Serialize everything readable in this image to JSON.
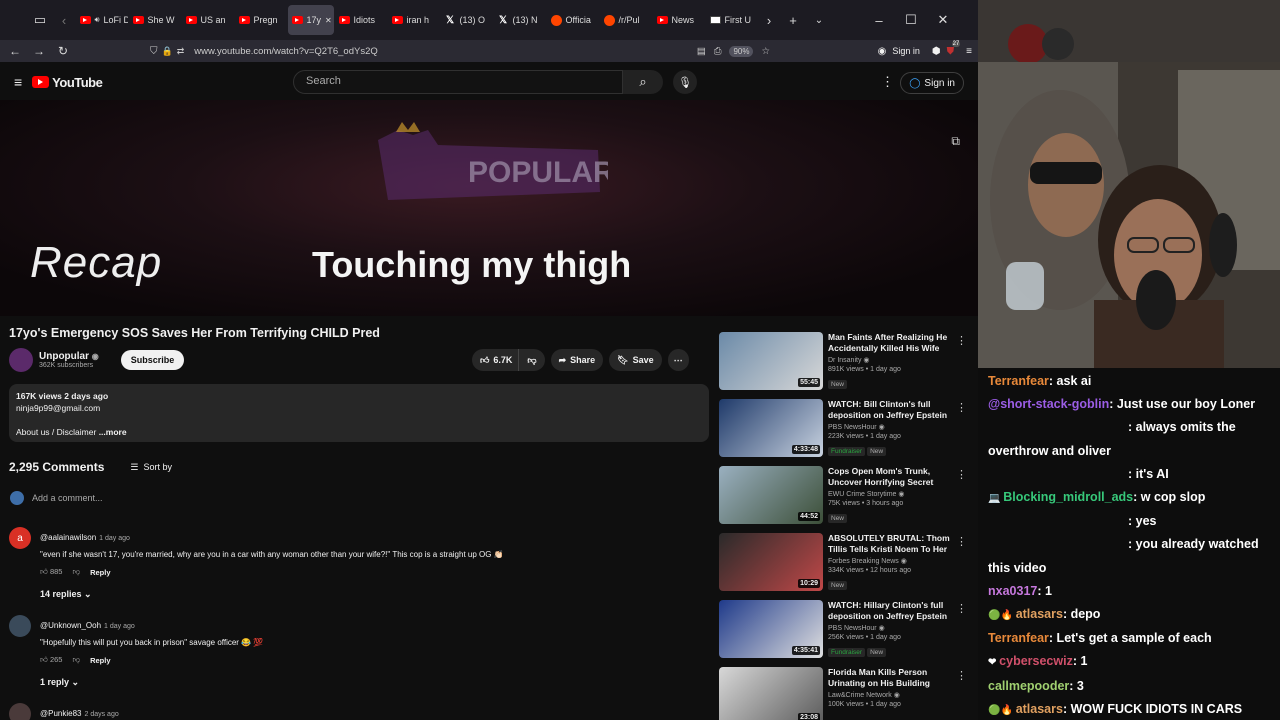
{
  "browser": {
    "tabs": [
      {
        "label": "LoFi D",
        "favicon": "youtube",
        "audio": true
      },
      {
        "label": "She W",
        "favicon": "youtube"
      },
      {
        "label": "US an",
        "favicon": "youtube"
      },
      {
        "label": "Pregn",
        "favicon": "youtube"
      },
      {
        "label": "17y",
        "favicon": "youtube",
        "active": true
      },
      {
        "label": "Idiots",
        "favicon": "youtube"
      },
      {
        "label": "iran h",
        "favicon": "youtube"
      },
      {
        "label": "(13) O",
        "favicon": "x"
      },
      {
        "label": "(13) N",
        "favicon": "x"
      },
      {
        "label": "Officia",
        "favicon": "reddit"
      },
      {
        "label": "/r/Pul",
        "favicon": "reddit"
      },
      {
        "label": "News",
        "favicon": "youtube"
      },
      {
        "label": "First U",
        "favicon": "news"
      }
    ],
    "url": "www.youtube.com/watch?v=Q2T6_odYs2Q",
    "zoom": "90%",
    "signin_label": "Sign in",
    "extension_badge": "27"
  },
  "youtube": {
    "logo_text": "YouTube",
    "search_placeholder": "Search",
    "signin_label": "Sign in",
    "player": {
      "watermark": "POPULAR",
      "left_text": "Recap",
      "caption": "Touching my thigh"
    },
    "video": {
      "title": "17yo's Emergency SOS Saves Her From Terrifying CHILD Pred",
      "channel": "Unpopular",
      "subscribers": "362K subscribers",
      "subscribe_label": "Subscribe",
      "likes": "6.7K",
      "share_label": "Share",
      "save_label": "Save"
    },
    "description": {
      "stats": "167K views  2 days ago",
      "email": "ninja9p99@gmail.com",
      "about": "About us / Disclaimer",
      "more": "...more"
    },
    "comments": {
      "count": "2,295 Comments",
      "sort_label": "Sort by",
      "add_placeholder": "Add a comment...",
      "items": [
        {
          "user": "@aalainawilson",
          "time": "1 day ago",
          "text": "\"even if she wasn't 17, you're married, why are you in a car with any woman other than your wife?!\" This cop is a straight up OG 👏🏻",
          "likes": "885",
          "reply_label": "Reply",
          "replies": "14 replies",
          "avatar_letter": "a",
          "avatar_color": "#d93025"
        },
        {
          "user": "@Unknown_Ooh",
          "time": "1 day ago",
          "text": "\"Hopefully this will put you back in prison\" savage officer 😂 💯",
          "likes": "265",
          "reply_label": "Reply",
          "replies": "1 reply",
          "avatar_letter": "",
          "avatar_color": "#3a4a5a"
        },
        {
          "user": "@Punkie83",
          "time": "2 days ago",
          "text": "",
          "likes": "",
          "reply_label": "",
          "replies": "",
          "avatar_letter": "",
          "avatar_color": "#4a3a3a"
        }
      ]
    },
    "recommendations": [
      {
        "title": "Man Faints After Realizing He Accidentally Killed His Wife",
        "channel": "Dr Insanity",
        "meta": "891K views • 1 day ago",
        "duration": "55:45",
        "badges": [
          "New"
        ],
        "thumb": [
          "#6b8aa8",
          "#d8d8d8"
        ]
      },
      {
        "title": "WATCH: Bill Clinton's full deposition on Jeffrey Epstein ...",
        "channel": "PBS NewsHour",
        "meta": "223K views • 1 day ago",
        "duration": "4:33:48",
        "badges": [
          "Fundraiser",
          "New"
        ],
        "thumb": [
          "#1f3a6a",
          "#c9d3e0"
        ]
      },
      {
        "title": "Cops Open Mom's Trunk, Uncover Horrifying Secret",
        "channel": "EWU Crime Storytime",
        "meta": "75K views • 3 hours ago",
        "duration": "44:52",
        "badges": [
          "New"
        ],
        "thumb": [
          "#9ab0c0",
          "#3c4f38"
        ]
      },
      {
        "title": "ABSOLUTELY BRUTAL: Thom Tillis Tells Kristi Noem To Her ...",
        "channel": "Forbes Breaking News",
        "meta": "334K views • 12 hours ago",
        "duration": "10:29",
        "badges": [
          "New"
        ],
        "thumb": [
          "#2a2a2a",
          "#c04848"
        ]
      },
      {
        "title": "WATCH: Hillary Clinton's full deposition on Jeffrey Epstein ...",
        "channel": "PBS NewsHour",
        "meta": "256K views • 1 day ago",
        "duration": "4:35:41",
        "badges": [
          "Fundraiser",
          "New"
        ],
        "thumb": [
          "#1f3a8a",
          "#e0e0e0"
        ]
      },
      {
        "title": "Florida Man Kills Person Urinating on His Building",
        "channel": "Law&Crime Network",
        "meta": "100K views • 1 day ago",
        "duration": "23:08",
        "badges": [],
        "thumb": [
          "#d8d8d8",
          "#5a5a5a"
        ]
      }
    ]
  },
  "stream_chat": [
    {
      "user": "Terranfear",
      "color": "#e8893a",
      "msg": ": ask ai"
    },
    {
      "user": "@short-stack-goblin",
      "color": "#9b5de5",
      "msg": ": Just use our boy Loner"
    },
    {
      "user": "",
      "color": "#ffffff",
      "msg": ": always omits the",
      "cont": true
    },
    {
      "user": "",
      "color": "#ffffff",
      "msg": "overthrow and oliver"
    },
    {
      "user": "",
      "color": "#ffffff",
      "msg": ": it's AI",
      "cont": true
    },
    {
      "user": "Blocking_midroll_ads",
      "color": "#37c87a",
      "msg": ": w cop slop",
      "badge": "💻"
    },
    {
      "user": "",
      "color": "#ffffff",
      "msg": ": yes",
      "cont": true
    },
    {
      "user": "",
      "color": "#ffffff",
      "msg": ": you already watched",
      "cont": true
    },
    {
      "user": "",
      "color": "#ffffff",
      "msg": "this video"
    },
    {
      "user": "nxa0317",
      "color": "#c678dd",
      "msg": ": 1"
    },
    {
      "user": "atlasars",
      "color": "#e0a060",
      "msg": ": depo",
      "badge": "🟢🔥"
    },
    {
      "user": "Terranfear",
      "color": "#e8893a",
      "msg": ": Let's get a sample of each"
    },
    {
      "user": "cybersecwiz",
      "color": "#d0506a",
      "msg": ": 1",
      "badge": "❤"
    },
    {
      "user": "callmepooder",
      "color": "#a0d070",
      "msg": ": 3"
    },
    {
      "user": "atlasars",
      "color": "#e0a060",
      "msg": ": WOW FUCK IDIOTS IN CARS",
      "badge": "🟢🔥"
    }
  ]
}
